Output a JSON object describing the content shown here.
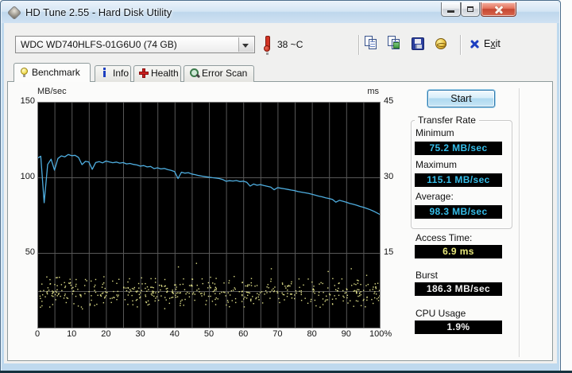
{
  "window": {
    "title": "HD Tune 2.55 - Hard Disk Utility"
  },
  "icons": {
    "app": "hd-tune-app-icon",
    "temperature": "thermometer-icon",
    "copy_text": "copy-pages-icon",
    "copy_image": "copy-image-icon",
    "save": "floppy-save-icon",
    "website": "gold-globe-icon",
    "exit": "blue-x-icon",
    "benchmark_tab": "bulb-icon",
    "info_tab": "info-icon",
    "health_tab": "red-cross-icon",
    "error_scan_tab": "magnifier-icon"
  },
  "toolbar": {
    "drive_select": "WDC WD740HLFS-01G6U0 (74 GB)",
    "temperature": "38 ~C",
    "exit": {
      "pre": "E",
      "accel": "x",
      "post": "it"
    }
  },
  "tabs": [
    {
      "label": "Benchmark",
      "active": true
    },
    {
      "label": "Info",
      "active": false
    },
    {
      "label": "Health",
      "active": false
    },
    {
      "label": "Error Scan",
      "active": false
    }
  ],
  "panel": {
    "start_button": "Start",
    "transfer_rate_group": "Transfer Rate",
    "minimum_label": "Minimum",
    "minimum_value": "75.2 MB/sec",
    "maximum_label": "Maximum",
    "maximum_value": "115.1 MB/sec",
    "average_label": "Average:",
    "average_value": "98.3 MB/sec",
    "access_time_label": "Access Time:",
    "access_time_value": "6.9 ms",
    "burst_label": "Burst",
    "burst_value": "186.3 MB/sec",
    "cpu_label": "CPU Usage",
    "cpu_value": "1.9%"
  },
  "colors": {
    "line_blue": "#4faee0",
    "scatter_yellow": "#e9e98e",
    "value_cyan": "#35bde9",
    "value_yellow": "#e8e87c",
    "plot_background": "#000000",
    "grid_grey": "#585858",
    "plot_border": "#7d7d7d",
    "close_button_red": "#c64832"
  },
  "chart_data": {
    "type": "line+scatter",
    "title": "HD Tune benchmark graph",
    "left_axis": {
      "label": "MB/sec",
      "min": 0,
      "max": 150,
      "ticks": [
        {
          "v": 150,
          "label": "150"
        },
        {
          "v": 100,
          "label": "100"
        },
        {
          "v": 50,
          "label": "50"
        }
      ]
    },
    "right_axis": {
      "label": "ms",
      "min": 0,
      "max": 45,
      "ticks": [
        {
          "v": 45,
          "label": "45"
        },
        {
          "v": 30,
          "label": "30"
        },
        {
          "v": 15,
          "label": "15"
        }
      ]
    },
    "x_axis": {
      "unit": "%",
      "min": 0,
      "max": 100,
      "grid_step_percent": 5,
      "ticks": [
        {
          "v": 0,
          "label": "0"
        },
        {
          "v": 10,
          "label": "10"
        },
        {
          "v": 20,
          "label": "20"
        },
        {
          "v": 30,
          "label": "30"
        },
        {
          "v": 40,
          "label": "40"
        },
        {
          "v": 50,
          "label": "50"
        },
        {
          "v": 60,
          "label": "60"
        },
        {
          "v": 70,
          "label": "70"
        },
        {
          "v": 80,
          "label": "80"
        },
        {
          "v": 90,
          "label": "90"
        },
        {
          "v": 100,
          "label": "100%"
        }
      ]
    },
    "gridlines_mbsec": [
      100,
      50,
      25
    ],
    "transfer_rate": {
      "name": "Transfer Rate (MB/sec)",
      "color": "#4faee0",
      "x_step": 1,
      "values": [
        112.6,
        114.0,
        83.2,
        108.5,
        112.0,
        104.8,
        112.5,
        114.2,
        113.6,
        115.1,
        114.3,
        114.6,
        113.2,
        108.4,
        110.6,
        110.2,
        105.3,
        109.8,
        110.4,
        109.6,
        110.8,
        110.2,
        109.7,
        110.1,
        109.4,
        109.8,
        108.9,
        109.2,
        108.6,
        108.2,
        107.4,
        107.8,
        106.9,
        107.2,
        105.8,
        106.3,
        105.6,
        105.9,
        105.1,
        104.6,
        103.8,
        99.2,
        103.4,
        102.8,
        103.1,
        102.2,
        101.8,
        101.2,
        100.8,
        100.4,
        100.1,
        99.8,
        99.6,
        99.2,
        98.6,
        97.4,
        97.8,
        97.6,
        97.9,
        97.2,
        97.5,
        96.8,
        94.2,
        95.6,
        94.8,
        95.2,
        94.6,
        94.1,
        93.6,
        91.8,
        93.2,
        92.8,
        92.4,
        92.0,
        91.6,
        91.2,
        90.6,
        90.2,
        89.8,
        89.4,
        88.8,
        88.2,
        87.6,
        87.1,
        86.5,
        86.0,
        85.4,
        83.6,
        84.8,
        84.2,
        83.6,
        82.8,
        82.2,
        81.6,
        80.8,
        80.2,
        79.4,
        78.6,
        77.6,
        76.4,
        75.2
      ]
    },
    "access_time_scatter": {
      "name": "Access Time (ms)",
      "color": "#e9e98e",
      "count": 520,
      "mean_ms": 7.2,
      "spread_ms": 3.4,
      "outlier_rate": 0.06,
      "min_ms": 3.8,
      "max_ms": 13.8,
      "seed": 1234567
    }
  }
}
